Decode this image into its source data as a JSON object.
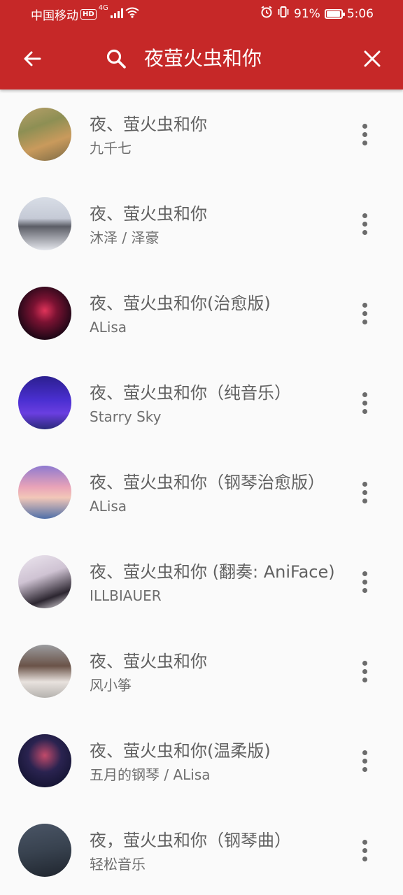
{
  "status_bar": {
    "carrier": "中国移动",
    "hd": "HD",
    "network": "4G",
    "battery": "91%",
    "battery_level": 0.91,
    "time": "5:06"
  },
  "toolbar": {
    "query": "夜萤火虫和你"
  },
  "colors": {
    "primary": "#c62828",
    "background": "#fafafa",
    "title_text": "#616161"
  },
  "results": [
    {
      "title": "夜、萤火虫和你",
      "artist": "九千七",
      "art": "linear-gradient(160deg,#b9a06a 0%,#8d8f54 35%,#c99a5c 65%,#7b6a45 100%)"
    },
    {
      "title": "夜、萤火虫和你",
      "artist": "沐泽 / 泽豪",
      "art": "linear-gradient(180deg,#d8dde6 0%,#c5cad6 40%,#5b5d66 55%,#e4e6ec 100%)"
    },
    {
      "title": "夜、萤火虫和你(治愈版)",
      "artist": "ALisa",
      "art": "radial-gradient(circle at 50% 45%,#e0345a 0%,#7a1232 30%,#240818 70%,#10050c 100%)"
    },
    {
      "title": "夜、萤火虫和你（纯音乐）",
      "artist": "Starry Sky",
      "art": "linear-gradient(180deg,#2b1f8f 0%,#4a2fd1 45%,#6a3ee0 70%,#2a2a7a 100%)"
    },
    {
      "title": "夜、萤火虫和你（钢琴治愈版）",
      "artist": "ALisa",
      "art": "linear-gradient(180deg,#8f7ad0 0%,#e9a3b8 40%,#f2c7b8 60%,#4f6fa8 100%)"
    },
    {
      "title": "夜、萤火虫和你 (翻奏: AniFace)",
      "artist": "ILLBIAUER",
      "art": "linear-gradient(160deg,#ece6ef 0%,#cfc3d3 40%,#2c2630 75%,#f1edf2 100%)"
    },
    {
      "title": "夜、萤火虫和你",
      "artist": "风小筝",
      "art": "linear-gradient(180deg,#9b9c9f 0%,#6a5348 40%,#e8e2de 70%,#b5b2ae 100%)"
    },
    {
      "title": "夜、萤火虫和你(温柔版)",
      "artist": "五月的钢琴 / ALisa",
      "art": "radial-gradient(circle at 50% 40%,#c24a6a 0%,#2a2350 40%,#141432 80%,#0d0d22 100%)"
    },
    {
      "title": "夜，萤火虫和你（钢琴曲）",
      "artist": "轻松音乐",
      "art": "linear-gradient(170deg,#4a5566 0%,#38424f 50%,#1f252e 100%)"
    }
  ]
}
